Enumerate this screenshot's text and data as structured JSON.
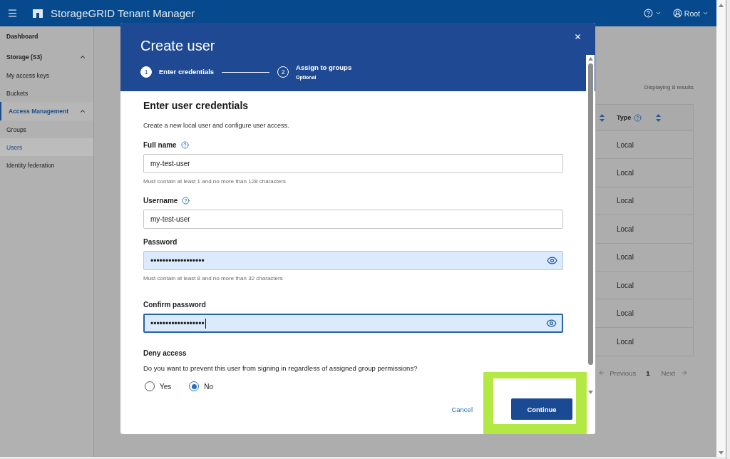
{
  "header": {
    "title": "StorageGRID Tenant Manager",
    "user": "Root"
  },
  "sidebar": {
    "items": [
      {
        "kind": "link",
        "label": "Dashboard",
        "selected": false
      },
      {
        "kind": "section",
        "label": "Storage (S3)",
        "selected": false,
        "expanded": true,
        "children": [
          {
            "label": "My access keys",
            "selected": false
          },
          {
            "label": "Buckets",
            "selected": false
          }
        ]
      },
      {
        "kind": "section",
        "label": "Access Management",
        "selected": true,
        "expanded": true,
        "children": [
          {
            "label": "Groups",
            "selected": false
          },
          {
            "label": "Users",
            "selected": true
          },
          {
            "label": "Identity federation",
            "selected": false
          }
        ]
      }
    ]
  },
  "users_page": {
    "results_text": "Displaying 8 results",
    "table": {
      "columns": [
        {
          "label": "Type",
          "help": true
        }
      ],
      "rows": [
        {
          "type": "Local"
        },
        {
          "type": "Local"
        },
        {
          "type": "Local"
        },
        {
          "type": "Local"
        },
        {
          "type": "Local"
        },
        {
          "type": "Local"
        },
        {
          "type": "Local"
        },
        {
          "type": "Local"
        }
      ]
    },
    "pagination": {
      "previous": "Previous",
      "page": "1",
      "next": "Next"
    }
  },
  "dialog": {
    "title": "Create user",
    "steps": [
      {
        "number": "1",
        "label": "Enter credentials",
        "selected": true
      },
      {
        "number": "2",
        "label": "Assign to groups",
        "sublabel": "Optional",
        "selected": false
      }
    ],
    "heading": "Enter user credentials",
    "description": "Create a new local user and configure user access.",
    "fields": [
      {
        "kind": "text",
        "label": "Full name",
        "help": true,
        "value": "my-test-user",
        "hint": "Must contain at least 1 and no more than 128 characters",
        "autofilled": false,
        "focused": false
      },
      {
        "kind": "text",
        "label": "Username",
        "help": true,
        "value": "my-test-user",
        "autofilled": false,
        "focused": false
      },
      {
        "kind": "password",
        "label": "Password",
        "value": "••••••••••••••••••",
        "hint": "Must contain at least 8 and no more than 32 characters",
        "autofilled": true,
        "focused": false
      },
      {
        "kind": "password",
        "label": "Confirm password",
        "value": "••••••••••••••••••",
        "autofilled": true,
        "focused": true
      }
    ],
    "deny_access": {
      "label": "Deny access",
      "question": "Do you want to prevent this user from signing in regardless of assigned group permissions?",
      "options": [
        {
          "label": "Yes",
          "selected": false
        },
        {
          "label": "No",
          "selected": true
        }
      ]
    },
    "buttons": {
      "cancel": "Cancel",
      "continue": "Continue"
    }
  }
}
